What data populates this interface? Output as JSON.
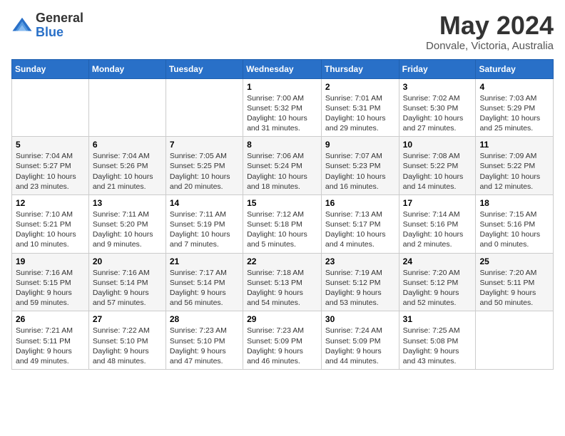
{
  "logo": {
    "general": "General",
    "blue": "Blue"
  },
  "header": {
    "month": "May 2024",
    "location": "Donvale, Victoria, Australia"
  },
  "days_of_week": [
    "Sunday",
    "Monday",
    "Tuesday",
    "Wednesday",
    "Thursday",
    "Friday",
    "Saturday"
  ],
  "weeks": [
    [
      {
        "day": "",
        "content": ""
      },
      {
        "day": "",
        "content": ""
      },
      {
        "day": "",
        "content": ""
      },
      {
        "day": "1",
        "content": "Sunrise: 7:00 AM\nSunset: 5:32 PM\nDaylight: 10 hours\nand 31 minutes."
      },
      {
        "day": "2",
        "content": "Sunrise: 7:01 AM\nSunset: 5:31 PM\nDaylight: 10 hours\nand 29 minutes."
      },
      {
        "day": "3",
        "content": "Sunrise: 7:02 AM\nSunset: 5:30 PM\nDaylight: 10 hours\nand 27 minutes."
      },
      {
        "day": "4",
        "content": "Sunrise: 7:03 AM\nSunset: 5:29 PM\nDaylight: 10 hours\nand 25 minutes."
      }
    ],
    [
      {
        "day": "5",
        "content": "Sunrise: 7:04 AM\nSunset: 5:27 PM\nDaylight: 10 hours\nand 23 minutes."
      },
      {
        "day": "6",
        "content": "Sunrise: 7:04 AM\nSunset: 5:26 PM\nDaylight: 10 hours\nand 21 minutes."
      },
      {
        "day": "7",
        "content": "Sunrise: 7:05 AM\nSunset: 5:25 PM\nDaylight: 10 hours\nand 20 minutes."
      },
      {
        "day": "8",
        "content": "Sunrise: 7:06 AM\nSunset: 5:24 PM\nDaylight: 10 hours\nand 18 minutes."
      },
      {
        "day": "9",
        "content": "Sunrise: 7:07 AM\nSunset: 5:23 PM\nDaylight: 10 hours\nand 16 minutes."
      },
      {
        "day": "10",
        "content": "Sunrise: 7:08 AM\nSunset: 5:22 PM\nDaylight: 10 hours\nand 14 minutes."
      },
      {
        "day": "11",
        "content": "Sunrise: 7:09 AM\nSunset: 5:22 PM\nDaylight: 10 hours\nand 12 minutes."
      }
    ],
    [
      {
        "day": "12",
        "content": "Sunrise: 7:10 AM\nSunset: 5:21 PM\nDaylight: 10 hours\nand 10 minutes."
      },
      {
        "day": "13",
        "content": "Sunrise: 7:11 AM\nSunset: 5:20 PM\nDaylight: 10 hours\nand 9 minutes."
      },
      {
        "day": "14",
        "content": "Sunrise: 7:11 AM\nSunset: 5:19 PM\nDaylight: 10 hours\nand 7 minutes."
      },
      {
        "day": "15",
        "content": "Sunrise: 7:12 AM\nSunset: 5:18 PM\nDaylight: 10 hours\nand 5 minutes."
      },
      {
        "day": "16",
        "content": "Sunrise: 7:13 AM\nSunset: 5:17 PM\nDaylight: 10 hours\nand 4 minutes."
      },
      {
        "day": "17",
        "content": "Sunrise: 7:14 AM\nSunset: 5:16 PM\nDaylight: 10 hours\nand 2 minutes."
      },
      {
        "day": "18",
        "content": "Sunrise: 7:15 AM\nSunset: 5:16 PM\nDaylight: 10 hours\nand 0 minutes."
      }
    ],
    [
      {
        "day": "19",
        "content": "Sunrise: 7:16 AM\nSunset: 5:15 PM\nDaylight: 9 hours\nand 59 minutes."
      },
      {
        "day": "20",
        "content": "Sunrise: 7:16 AM\nSunset: 5:14 PM\nDaylight: 9 hours\nand 57 minutes."
      },
      {
        "day": "21",
        "content": "Sunrise: 7:17 AM\nSunset: 5:14 PM\nDaylight: 9 hours\nand 56 minutes."
      },
      {
        "day": "22",
        "content": "Sunrise: 7:18 AM\nSunset: 5:13 PM\nDaylight: 9 hours\nand 54 minutes."
      },
      {
        "day": "23",
        "content": "Sunrise: 7:19 AM\nSunset: 5:12 PM\nDaylight: 9 hours\nand 53 minutes."
      },
      {
        "day": "24",
        "content": "Sunrise: 7:20 AM\nSunset: 5:12 PM\nDaylight: 9 hours\nand 52 minutes."
      },
      {
        "day": "25",
        "content": "Sunrise: 7:20 AM\nSunset: 5:11 PM\nDaylight: 9 hours\nand 50 minutes."
      }
    ],
    [
      {
        "day": "26",
        "content": "Sunrise: 7:21 AM\nSunset: 5:11 PM\nDaylight: 9 hours\nand 49 minutes."
      },
      {
        "day": "27",
        "content": "Sunrise: 7:22 AM\nSunset: 5:10 PM\nDaylight: 9 hours\nand 48 minutes."
      },
      {
        "day": "28",
        "content": "Sunrise: 7:23 AM\nSunset: 5:10 PM\nDaylight: 9 hours\nand 47 minutes."
      },
      {
        "day": "29",
        "content": "Sunrise: 7:23 AM\nSunset: 5:09 PM\nDaylight: 9 hours\nand 46 minutes."
      },
      {
        "day": "30",
        "content": "Sunrise: 7:24 AM\nSunset: 5:09 PM\nDaylight: 9 hours\nand 44 minutes."
      },
      {
        "day": "31",
        "content": "Sunrise: 7:25 AM\nSunset: 5:08 PM\nDaylight: 9 hours\nand 43 minutes."
      },
      {
        "day": "",
        "content": ""
      }
    ]
  ]
}
